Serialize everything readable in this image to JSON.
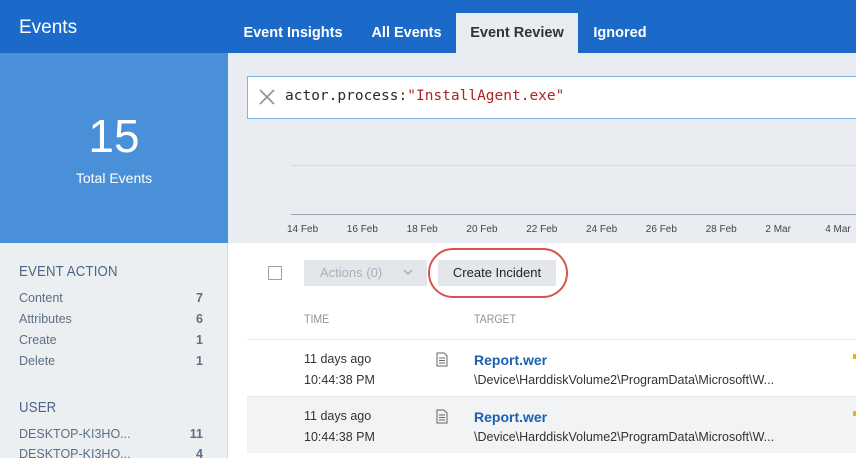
{
  "sidebar": {
    "title": "Events",
    "total_count": "15",
    "total_label": "Total Events",
    "facets": [
      {
        "heading": "EVENT ACTION",
        "items": [
          {
            "label": "Content",
            "count": "7"
          },
          {
            "label": "Attributes",
            "count": "6"
          },
          {
            "label": "Create",
            "count": "1"
          },
          {
            "label": "Delete",
            "count": "1"
          }
        ]
      },
      {
        "heading": "USER",
        "items": [
          {
            "label": "DESKTOP-KI3HO...",
            "count": "11"
          },
          {
            "label": "DESKTOP-KI3HO...",
            "count": "4"
          }
        ]
      }
    ]
  },
  "tabs": [
    {
      "label": "Event Insights",
      "active": false
    },
    {
      "label": "All Events",
      "active": false
    },
    {
      "label": "Event Review",
      "active": true
    },
    {
      "label": "Ignored",
      "active": false
    }
  ],
  "search": {
    "key": "actor.process",
    "separator": ":",
    "value": "\"InstallAgent.exe\""
  },
  "timeline": {
    "ticks": [
      "14 Feb",
      "16 Feb",
      "18 Feb",
      "20 Feb",
      "22 Feb",
      "24 Feb",
      "26 Feb",
      "28 Feb",
      "2 Mar",
      "4 Mar"
    ]
  },
  "toolbar": {
    "actions_label": "Actions (0)",
    "create_incident_label": "Create Incident"
  },
  "table": {
    "columns": [
      "TIME",
      "TARGET"
    ],
    "rows": [
      {
        "time": "11 days ago",
        "clock": "10:44:38 PM",
        "target": "Report.wer",
        "path": "\\Device\\HarddiskVolume2\\ProgramData\\Microsoft\\W..."
      },
      {
        "time": "11 days ago",
        "clock": "10:44:38 PM",
        "target": "Report.wer",
        "path": "\\Device\\HarddiskVolume2\\ProgramData\\Microsoft\\W..."
      }
    ]
  },
  "colors": {
    "brand_blue": "#1b6ac9",
    "card_blue": "#4a90d9",
    "link_blue": "#1b5fb3",
    "highlight_red": "#d9534f"
  }
}
